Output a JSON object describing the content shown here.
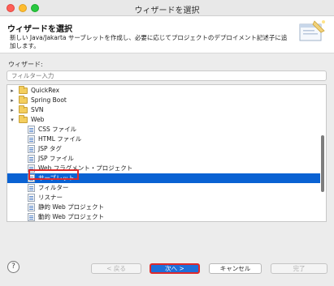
{
  "window": {
    "title": "ウィザードを選択"
  },
  "banner": {
    "title": "ウィザードを選択",
    "description": "新しい Java/Jakarta サーブレットを作成し、必要に応じてプロジェクトのデプロイメント記述子に追加します。"
  },
  "wizards_label": "ウィザード:",
  "filter": {
    "placeholder": "フィルター入力",
    "value": ""
  },
  "tree": {
    "items": [
      {
        "label": "QuickRex",
        "kind": "folder",
        "expanded": false
      },
      {
        "label": "Spring Boot",
        "kind": "folder",
        "expanded": false
      },
      {
        "label": "SVN",
        "kind": "folder",
        "expanded": false
      },
      {
        "label": "Web",
        "kind": "folder",
        "expanded": true
      },
      {
        "label": "CSS ファイル",
        "kind": "file"
      },
      {
        "label": "HTML ファイル",
        "kind": "file"
      },
      {
        "label": "JSP タグ",
        "kind": "file"
      },
      {
        "label": "JSP ファイル",
        "kind": "file"
      },
      {
        "label": "Web フラグメント・プロジェクト",
        "kind": "file"
      },
      {
        "label": "サーブレット",
        "kind": "file",
        "selected": true
      },
      {
        "label": "フィルター",
        "kind": "file"
      },
      {
        "label": "リスナー",
        "kind": "file"
      },
      {
        "label": "静的 Web プロジェクト",
        "kind": "file"
      },
      {
        "label": "動的 Web プロジェクト",
        "kind": "file"
      }
    ]
  },
  "buttons": {
    "help": "?",
    "back": "< 戻る",
    "next": "次へ >",
    "cancel": "キャンセル",
    "finish": "完了"
  },
  "colors": {
    "selection": "#0a62d3",
    "highlight_box": "#e0292a",
    "primary_button": "#1f6fd9"
  }
}
